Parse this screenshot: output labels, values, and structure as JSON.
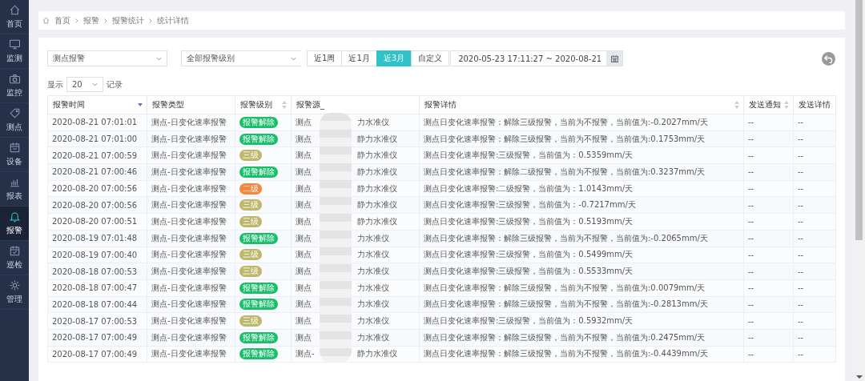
{
  "sidebar": {
    "items": [
      {
        "label": "首页",
        "selected": false
      },
      {
        "label": "监测",
        "selected": false
      },
      {
        "label": "监控",
        "selected": false
      },
      {
        "label": "测点",
        "selected": false
      },
      {
        "label": "设备",
        "selected": false
      },
      {
        "label": "报表",
        "selected": false
      },
      {
        "label": "报警",
        "selected": true
      },
      {
        "label": "巡检",
        "selected": false
      },
      {
        "label": "管理",
        "selected": false
      }
    ]
  },
  "breadcrumb": [
    "首页",
    "报警",
    "报警统计",
    "统计详情"
  ],
  "filters": {
    "point_select": "测点报警",
    "level_select": "全部报警级别",
    "ranges": [
      {
        "label": "近1周",
        "selected": false
      },
      {
        "label": "近1月",
        "selected": false
      },
      {
        "label": "近3月",
        "selected": true
      },
      {
        "label": "自定义",
        "selected": false
      }
    ],
    "date_range": "2020-05-23 17:11:27 ~ 2020-08-21"
  },
  "page_size": {
    "prefix": "显示",
    "value": "20",
    "suffix": "记录"
  },
  "table": {
    "columns": [
      {
        "label": "报警时间",
        "sortable": true,
        "sorted": true
      },
      {
        "label": "报警类型",
        "sortable": false,
        "sorted": false
      },
      {
        "label": "报警级别",
        "sortable": true,
        "sorted": false
      },
      {
        "label": "报警源_",
        "sortable": false,
        "sorted": false
      },
      {
        "label": "报警详情",
        "sortable": true,
        "sorted": false
      },
      {
        "label": "发送通知",
        "sortable": true,
        "sorted": false
      },
      {
        "label": "发送详情",
        "sortable": false,
        "sorted": false
      }
    ],
    "rows": [
      {
        "time": "2020-08-21 07:01:01",
        "type": "测点-日变化速率报警",
        "level": {
          "text": "报警解除",
          "color": "#19be6b"
        },
        "source_prefix": "测点",
        "source_suffix": "力水准仪",
        "detail": "测点日变化速率报警：解除三级报警，当前为不报警，当前值为:-0.2027mm/天",
        "notify": "--",
        "notify_detail": "--"
      },
      {
        "time": "2020-08-21 07:01:00",
        "type": "测点-日变化速率报警",
        "level": {
          "text": "报警解除",
          "color": "#19be6b"
        },
        "source_prefix": "测点",
        "source_suffix": "静力水准仪",
        "detail": "测点日变化速率报警：解除三级报警，当前为不报警，当前值为:0.1753mm/天",
        "notify": "--",
        "notify_detail": "--"
      },
      {
        "time": "2020-08-21 07:00:59",
        "type": "测点-日变化速率报警",
        "level": {
          "text": "三级",
          "color": "#bdb76b"
        },
        "source_prefix": "测点",
        "source_suffix": "静力水准仪",
        "detail": "测点日变化速率报警:三级报警，当前值为：0.5359mm/天",
        "notify": "--",
        "notify_detail": "--"
      },
      {
        "time": "2020-08-21 07:00:46",
        "type": "测点-日变化速率报警",
        "level": {
          "text": "报警解除",
          "color": "#19be6b"
        },
        "source_prefix": "测点",
        "source_suffix": "静力水准仪",
        "detail": "测点日变化速率报警：解除二级报警，当前为不报警，当前值为:0.3237mm/天",
        "notify": "--",
        "notify_detail": "--"
      },
      {
        "time": "2020-08-20 07:00:56",
        "type": "测点-日变化速率报警",
        "level": {
          "text": "二级",
          "color": "#f5873c"
        },
        "source_prefix": "测点",
        "source_suffix": "静力水准仪",
        "detail": "测点日变化速率报警:二级报警，当前值为：1.0143mm/天",
        "notify": "--",
        "notify_detail": "--"
      },
      {
        "time": "2020-08-20 07:00:56",
        "type": "测点-日变化速率报警",
        "level": {
          "text": "三级",
          "color": "#bdb76b"
        },
        "source_prefix": "测点",
        "source_suffix": "静力水准仪",
        "detail": "测点日变化速率报警:三级报警，当前值为：-0.7217mm/天",
        "notify": "--",
        "notify_detail": "--"
      },
      {
        "time": "2020-08-20 07:00:51",
        "type": "测点-日变化速率报警",
        "level": {
          "text": "三级",
          "color": "#bdb76b"
        },
        "source_prefix": "测点",
        "source_suffix": "静力水准仪",
        "detail": "测点日变化速率报警:三级报警，当前值为：0.5193mm/天",
        "notify": "--",
        "notify_detail": "--"
      },
      {
        "time": "2020-08-19 07:01:48",
        "type": "测点-日变化速率报警",
        "level": {
          "text": "报警解除",
          "color": "#19be6b"
        },
        "source_prefix": "测点",
        "source_suffix": "力水准仪",
        "detail": "测点日变化速率报警：解除三级报警，当前为不报警，当前值为:-0.2065mm/天",
        "notify": "--",
        "notify_detail": "--"
      },
      {
        "time": "2020-08-19 07:00:40",
        "type": "测点-日变化速率报警",
        "level": {
          "text": "三级",
          "color": "#bdb76b"
        },
        "source_prefix": "测点",
        "source_suffix": "力水准仪",
        "detail": "测点日变化速率报警:三级报警，当前值为：0.5499mm/天",
        "notify": "--",
        "notify_detail": "--"
      },
      {
        "time": "2020-08-18 07:00:53",
        "type": "测点-日变化速率报警",
        "level": {
          "text": "三级",
          "color": "#bdb76b"
        },
        "source_prefix": "测点",
        "source_suffix": "力水准仪",
        "detail": "测点日变化速率报警:三级报警，当前值为：0.5533mm/天",
        "notify": "--",
        "notify_detail": "--"
      },
      {
        "time": "2020-08-18 07:00:47",
        "type": "测点-日变化速率报警",
        "level": {
          "text": "报警解除",
          "color": "#19be6b"
        },
        "source_prefix": "测点",
        "source_suffix": "力水准仪",
        "detail": "测点日变化速率报警：解除三级报警，当前为不报警，当前值为:0.0079mm/天",
        "notify": "--",
        "notify_detail": "--"
      },
      {
        "time": "2020-08-18 07:00:44",
        "type": "测点-日变化速率报警",
        "level": {
          "text": "报警解除",
          "color": "#19be6b"
        },
        "source_prefix": "测点",
        "source_suffix": "力水准仪",
        "detail": "测点日变化速率报警：解除三级报警，当前为不报警，当前值为:-0.2813mm/天",
        "notify": "--",
        "notify_detail": "--"
      },
      {
        "time": "2020-08-17 07:00:53",
        "type": "测点-日变化速率报警",
        "level": {
          "text": "三级",
          "color": "#bdb76b"
        },
        "source_prefix": "测点",
        "source_suffix": "力水准仪",
        "detail": "测点日变化速率报警:三级报警，当前值为：0.5932mm/天",
        "notify": "--",
        "notify_detail": "--"
      },
      {
        "time": "2020-08-17 07:00:49",
        "type": "测点-日变化速率报警",
        "level": {
          "text": "报警解除",
          "color": "#19be6b"
        },
        "source_prefix": "测点",
        "source_suffix": "力水准仪",
        "detail": "测点日变化速率报警：解除三级报警，当前为不报警，当前值为:0.2475mm/天",
        "notify": "--",
        "notify_detail": "--"
      },
      {
        "time": "2020-08-17 07:00:49",
        "type": "测点-日变化速率报警",
        "level": {
          "text": "报警解除",
          "color": "#19be6b"
        },
        "source_prefix": "测点-",
        "source_suffix": "静力水准仪",
        "detail": "测点日变化速率报警：解除三级报警，当前为不报警，当前值为:-0.4439mm/天",
        "notify": "--",
        "notify_detail": "--"
      }
    ]
  }
}
